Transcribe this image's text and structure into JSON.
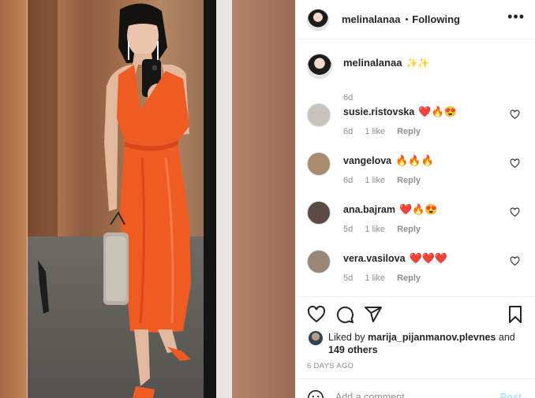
{
  "post": {
    "username": "melinalanaa",
    "follow_status": "Following",
    "separator": "•",
    "more_icon": "more-horizontal-icon"
  },
  "caption": {
    "username": "melinalanaa",
    "text": "✨✨",
    "time": "6d"
  },
  "comments": [
    {
      "username": "susie.ristovska",
      "text": "❤️🔥😍",
      "time": "6d",
      "likes": "1 like",
      "reply": "Reply",
      "avatar_color": "#c9c3bd"
    },
    {
      "username": "vangelova",
      "text": "🔥🔥🔥",
      "time": "6d",
      "likes": "1 like",
      "reply": "Reply",
      "avatar_color": "#a98a6c"
    },
    {
      "username": "ana.bajram",
      "text": "❤️🔥😍",
      "time": "5d",
      "likes": "1 like",
      "reply": "Reply",
      "avatar_color": "#5b4a43"
    },
    {
      "username": "vera.vasilova",
      "text": "❤️❤️❤️",
      "time": "5d",
      "likes": "1 like",
      "reply": "Reply",
      "avatar_color": "#9b8574"
    }
  ],
  "actions": {
    "like_icon": "heart-icon",
    "comment_icon": "comment-icon",
    "share_icon": "share-icon",
    "save_icon": "bookmark-icon"
  },
  "likes": {
    "prefix": "Liked by",
    "user": "marija_pijanmanov.plevnes",
    "connector": "and",
    "others": "149 others"
  },
  "date": "6 DAYS AGO",
  "add_comment": {
    "placeholder": "Add a comment...",
    "post_label": "Post"
  },
  "colors": {
    "text": "#262626",
    "muted": "#8e8e8e",
    "border": "#efefef",
    "post_disabled": "#b2dffc",
    "dress_orange": "#f05a23"
  }
}
